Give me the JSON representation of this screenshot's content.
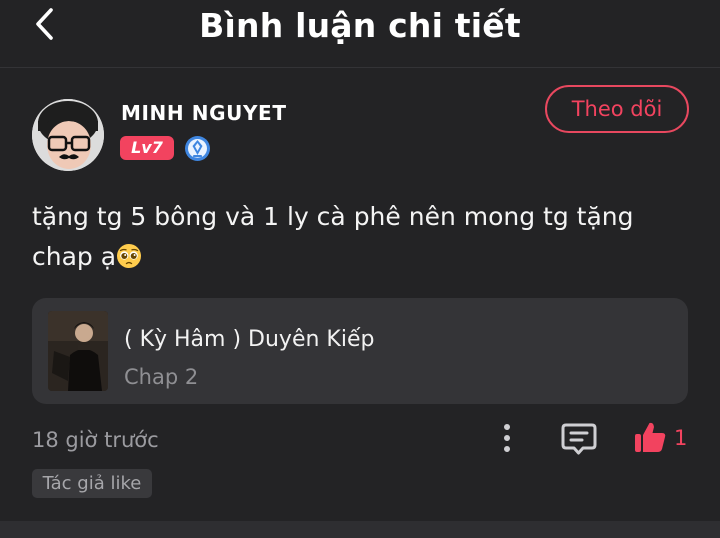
{
  "header": {
    "title": "Bình luận chi tiết",
    "back_icon": "chevron-left-icon"
  },
  "comment": {
    "user": {
      "name": "MINH NGUYET",
      "level": "Lv7",
      "rank_icon": "rank-diamond-icon"
    },
    "follow_label": "Theo dõi",
    "text": "tặng tg 5 bông và 1 ly cà phê nên mong tg tặng chap ạ",
    "emoji": "pleading-face-emoji",
    "story": {
      "title": "( Kỳ Hâm ) Duyên Kiếp",
      "chapter": "Chap 2"
    },
    "timestamp": "18 giờ trước",
    "like_count": "1",
    "author_tag": "Tác giả like"
  },
  "colors": {
    "background": "#232325",
    "accent": "#f2435f",
    "card": "#343437",
    "muted_text": "#9b9ba0"
  }
}
